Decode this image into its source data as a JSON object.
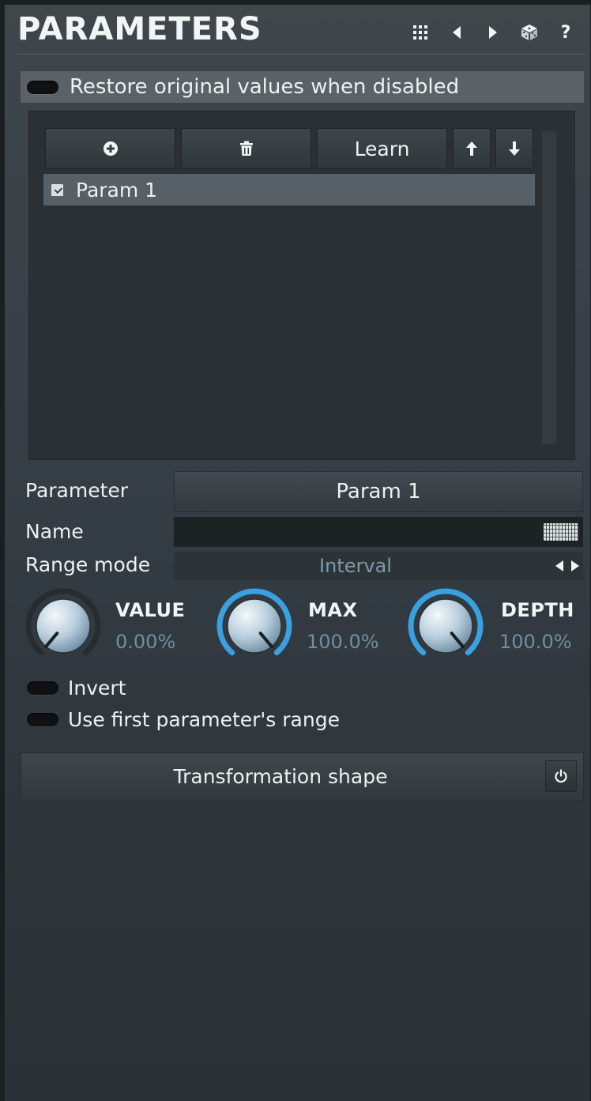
{
  "header": {
    "title": "PARAMETERS",
    "icons": [
      "grid-icon",
      "arrow-left-icon",
      "arrow-right-icon",
      "dice-icon",
      "help-icon"
    ],
    "help_label": "?"
  },
  "restore": {
    "label": "Restore original values when disabled",
    "enabled": false
  },
  "list_toolbar": {
    "learn_label": "Learn",
    "icons": [
      "add-icon",
      "trash-icon",
      "arrow-up-icon",
      "arrow-down-icon"
    ]
  },
  "param_list": {
    "items": [
      {
        "label": "Param 1",
        "checked": true
      }
    ]
  },
  "fields": {
    "parameter_label": "Parameter",
    "parameter_value": "Param 1",
    "name_label": "Name",
    "name_value": "",
    "range_label": "Range mode",
    "range_value": "Interval"
  },
  "knobs": [
    {
      "label": "VALUE",
      "value": "0.00%",
      "level": 0.0,
      "active": false
    },
    {
      "label": "MAX",
      "value": "100.0%",
      "level": 1.0,
      "active": true
    },
    {
      "label": "DEPTH",
      "value": "100.0%",
      "level": 1.0,
      "active": true
    }
  ],
  "toggles": {
    "invert_label": "Invert",
    "first_range_label": "Use first parameter's range"
  },
  "transformation": {
    "label": "Transformation shape"
  },
  "colors": {
    "accent": "#3aa0e0",
    "value_text": "#6f8fa0",
    "background": "#38404a"
  }
}
